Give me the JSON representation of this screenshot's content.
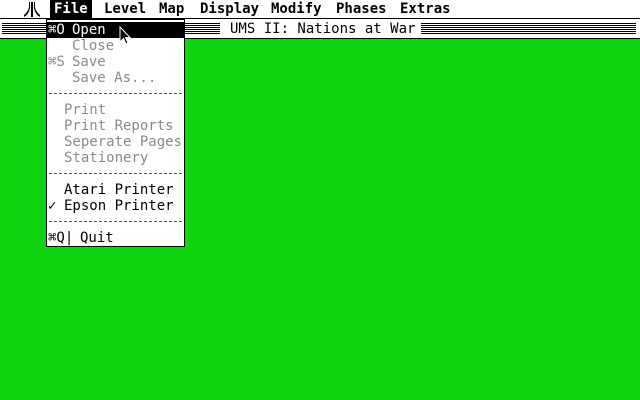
{
  "menubar": {
    "items": [
      "File",
      "Level",
      "Map",
      "Display",
      "Modify",
      "Phases",
      "Extras"
    ],
    "active": "File"
  },
  "window": {
    "title": "UMS II: Nations at War"
  },
  "file_menu": {
    "items": [
      {
        "shortcut": "⌘O",
        "label": "Open",
        "state": "selected"
      },
      {
        "shortcut": "",
        "label": "Close",
        "state": "disabled"
      },
      {
        "shortcut": "⌘S",
        "label": "Save",
        "state": "disabled"
      },
      {
        "shortcut": "",
        "label": "Save As...",
        "state": "disabled"
      },
      {
        "label": "Print",
        "state": "disabled"
      },
      {
        "label": "Print Reports",
        "state": "disabled"
      },
      {
        "label": "Seperate Pages",
        "state": "disabled"
      },
      {
        "label": "Stationery",
        "state": "disabled"
      },
      {
        "label": "Atari Printer",
        "state": "enabled"
      },
      {
        "label": "Epson Printer",
        "state": "enabled",
        "checked": true,
        "check_mark": "✓"
      },
      {
        "shortcut": "⌘Q|",
        "label": "Quit",
        "state": "enabled"
      }
    ]
  },
  "colors": {
    "desktop": "#10d410",
    "disabled_text": "#8a8a8a"
  }
}
